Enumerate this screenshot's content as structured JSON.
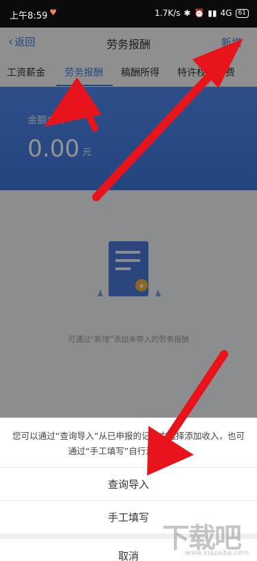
{
  "status_bar": {
    "time": "上午8:59",
    "speed": "1.7K/s",
    "network": "4G",
    "battery": "61"
  },
  "header": {
    "back_label": "返回",
    "title": "劳务报酬",
    "add_label": "新增"
  },
  "tabs": [
    {
      "label": "工资薪金",
      "active": false
    },
    {
      "label": "劳务报酬",
      "active": true
    },
    {
      "label": "稿酬所得",
      "active": false
    },
    {
      "label": "特许权使用费",
      "active": false
    }
  ],
  "summary": {
    "label": "金额合计",
    "amount": "0.00",
    "unit": "元"
  },
  "empty_state": {
    "text": "可通过“新增”添加未带入的劳务报酬"
  },
  "action_sheet": {
    "message": "您可以通过“查询导入”从已申报的记录中选择添加收入，也可通过“手工填写”自行添加收入。",
    "query_import_label": "查询导入",
    "manual_fill_label": "手工填写",
    "cancel_label": "取消"
  },
  "watermark": {
    "text": "下载吧",
    "url": "www.xiazaiba.com"
  },
  "colors": {
    "accent": "#3b7de0",
    "banner": "#4f88ea",
    "arrow": "#e8141c"
  }
}
